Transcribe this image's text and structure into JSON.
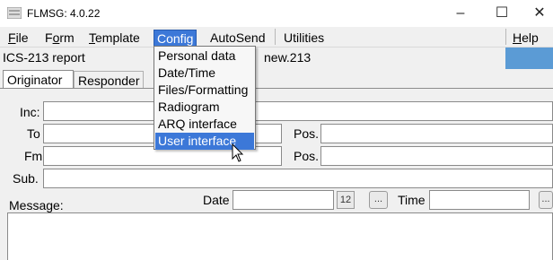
{
  "window": {
    "title": "FLMSG: 4.0.22",
    "minimize": "–",
    "maximize": "☐",
    "close": "✕"
  },
  "menubar": {
    "items": [
      "File",
      "Form",
      "Template",
      "Config",
      "AutoSend",
      "Utilities"
    ],
    "help": "Help"
  },
  "report": {
    "title": "ICS-213 report",
    "file": "new.213"
  },
  "tabs": [
    "Originator",
    "Responder"
  ],
  "form": {
    "inc_label": "Inc:",
    "to_label": "To",
    "fm_label": "Fm",
    "pos_label": "Pos.",
    "sub_label": "Sub.",
    "message_label": "Message:",
    "date_label": "Date",
    "time_label": "Time",
    "calendar_label": "12",
    "ellipsis": "..."
  },
  "config_menu": {
    "items": [
      "Personal data",
      "Date/Time",
      "Files/Formatting",
      "Radiogram",
      "ARQ interface",
      "User interface"
    ],
    "highlighted": "User interface"
  },
  "colors": {
    "highlight": "#3c78d8",
    "accent_button": "#5b9bd5"
  }
}
